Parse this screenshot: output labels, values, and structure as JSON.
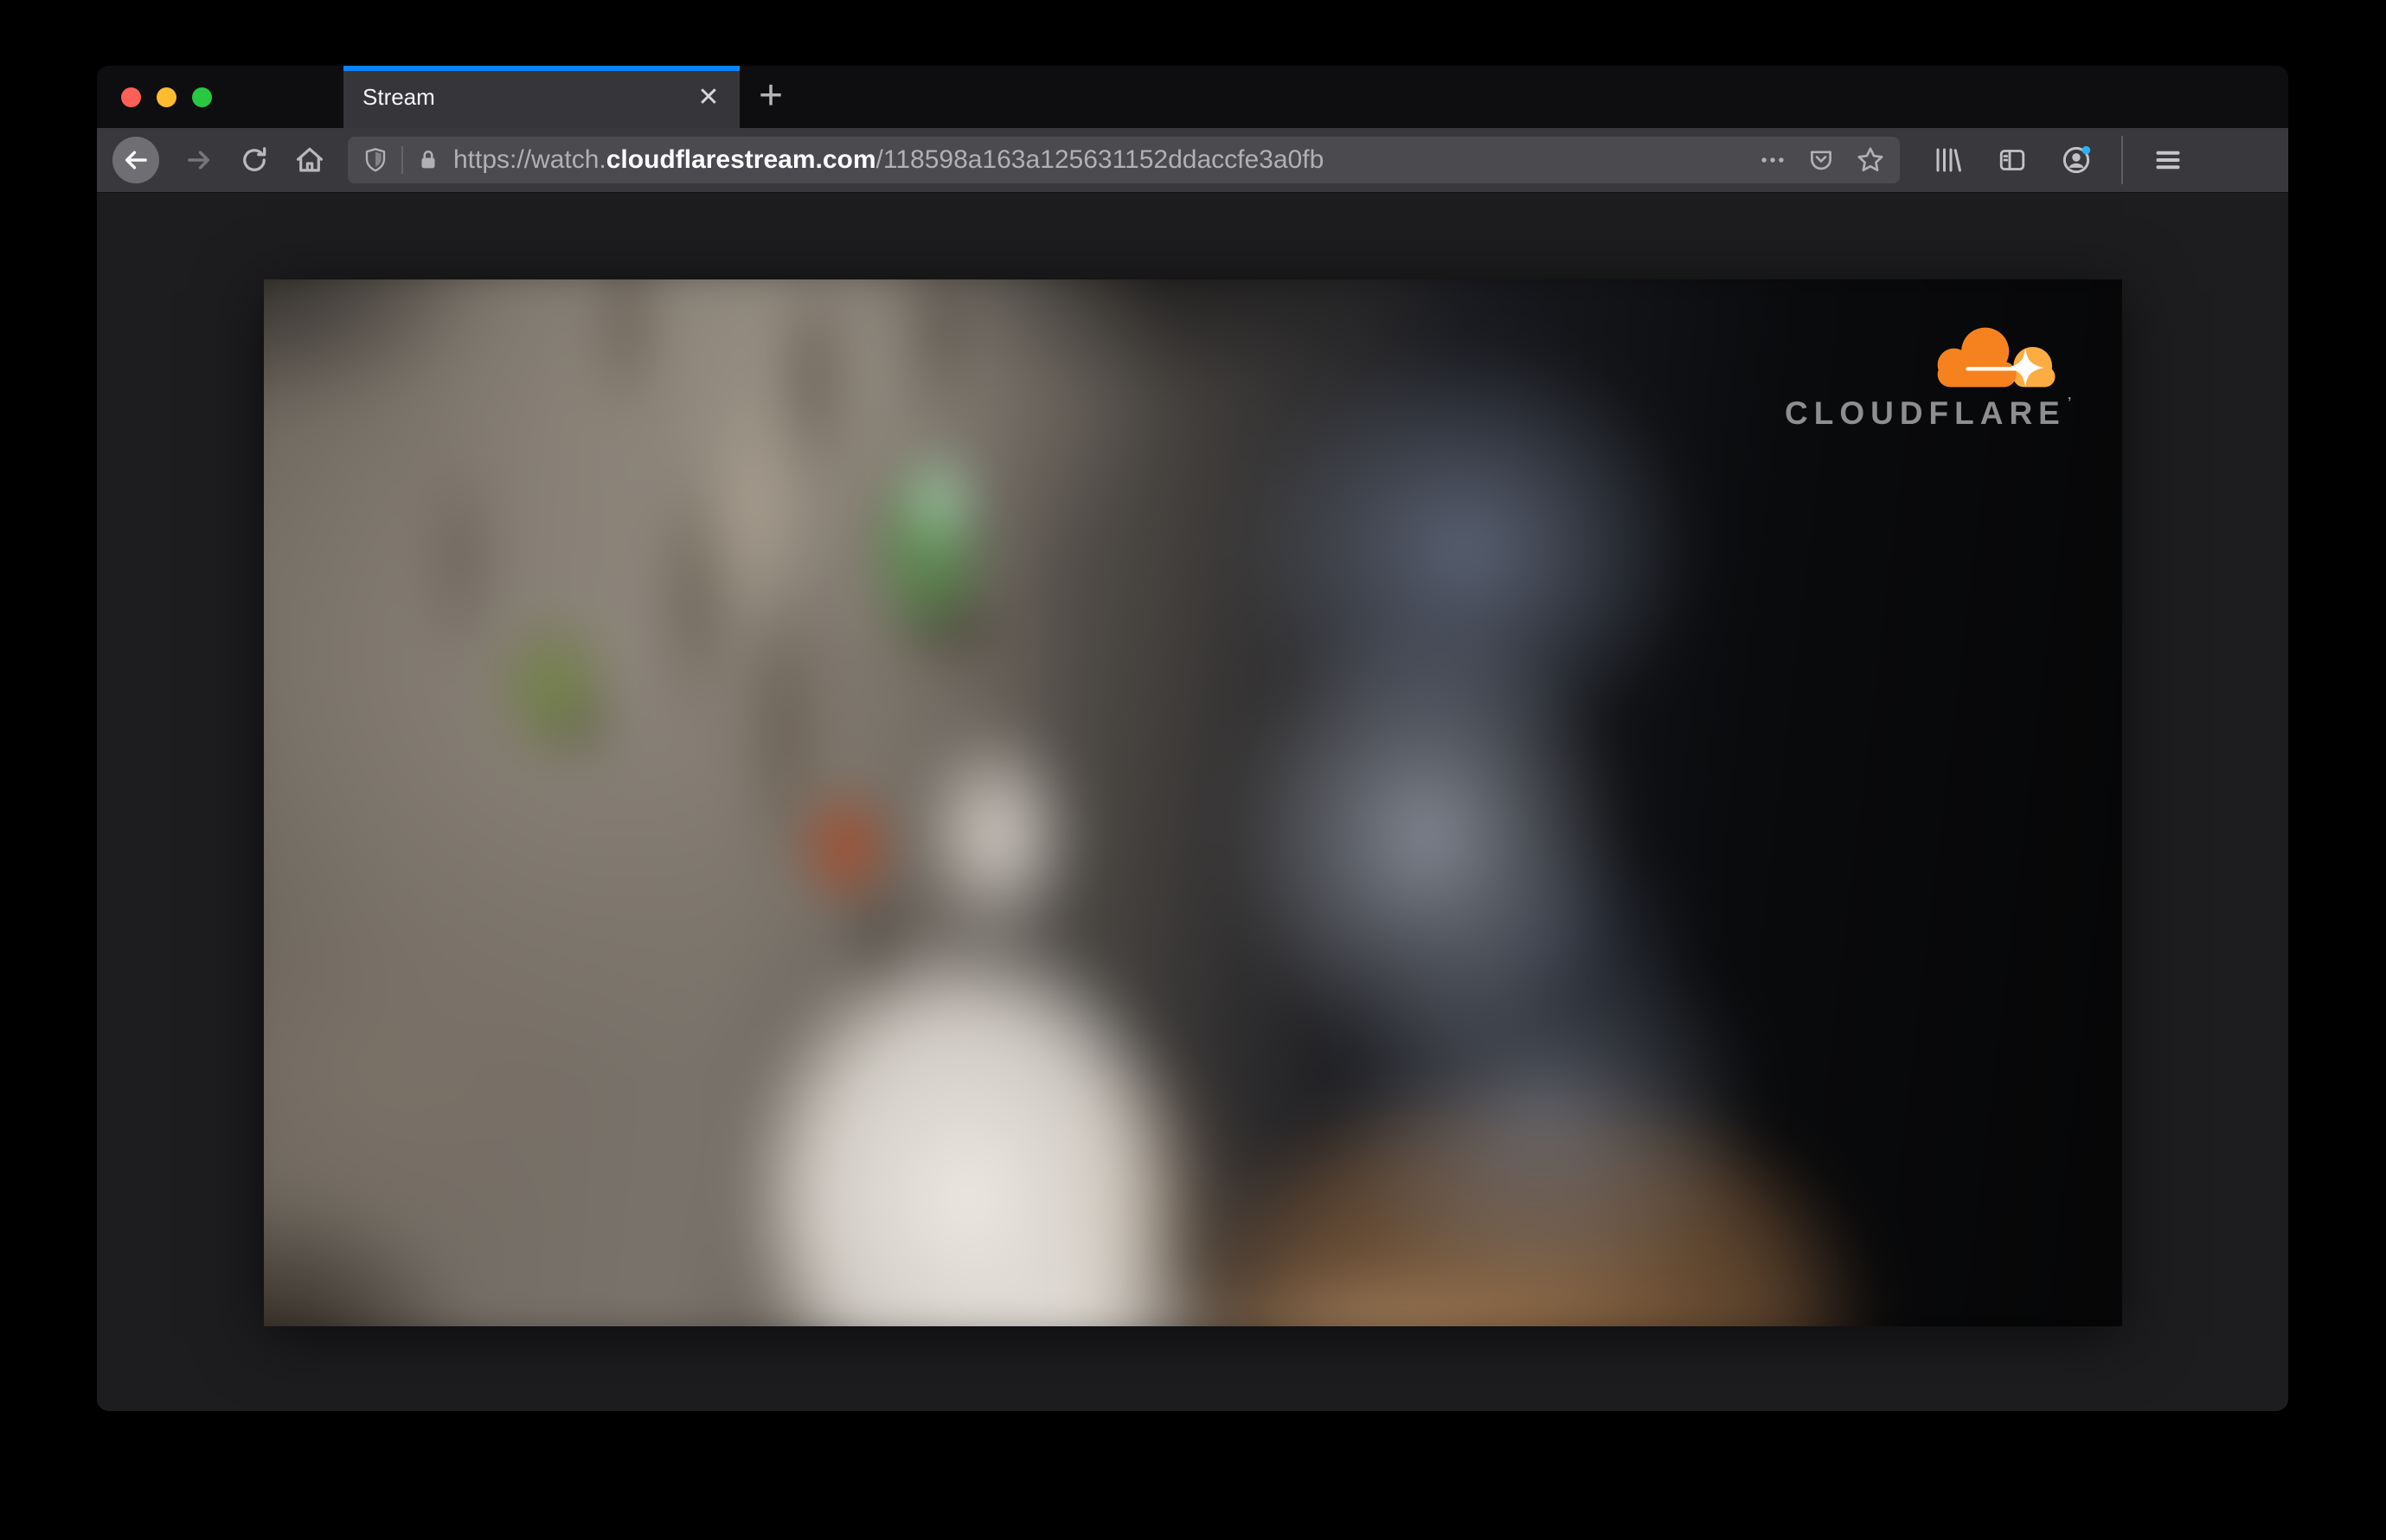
{
  "window": {
    "traffic_lights": {
      "close_color": "#ff5f57",
      "minimize_color": "#febc2e",
      "zoom_color": "#28c840"
    },
    "tab_bar": {
      "active_tab": {
        "title": "Stream",
        "close_glyph": "✕"
      },
      "new_tab_glyph": "+",
      "accent_color": "#0a84ff"
    },
    "toolbar": {
      "url_bar": {
        "scheme": "https://watch.",
        "domain": "cloudflarestream.com",
        "path": "/118598a163a125631152ddaccfe3a0fb"
      },
      "icons": {
        "back": "left-arrow-in-circle",
        "forward": "right-arrow",
        "reload": "circular-arrow",
        "home": "house",
        "tracking_protection": "shield",
        "connection_secure": "lock",
        "page_actions": "ellipsis",
        "pocket": "badge-chevron-down",
        "bookmark": "star-outline",
        "library": "slanted-books",
        "sidebar": "split-panel",
        "account": "person-in-circle",
        "menu": "hamburger"
      },
      "account_badge_color": "#29b2f8"
    }
  },
  "video_player": {
    "brand": {
      "wordmark": "CLOUDFLARE",
      "trademark_tick": "’",
      "cloud_color": "#f6821f",
      "cloud_highlight_color": "#fbad41",
      "wordmark_color": "#8e8e90"
    }
  }
}
